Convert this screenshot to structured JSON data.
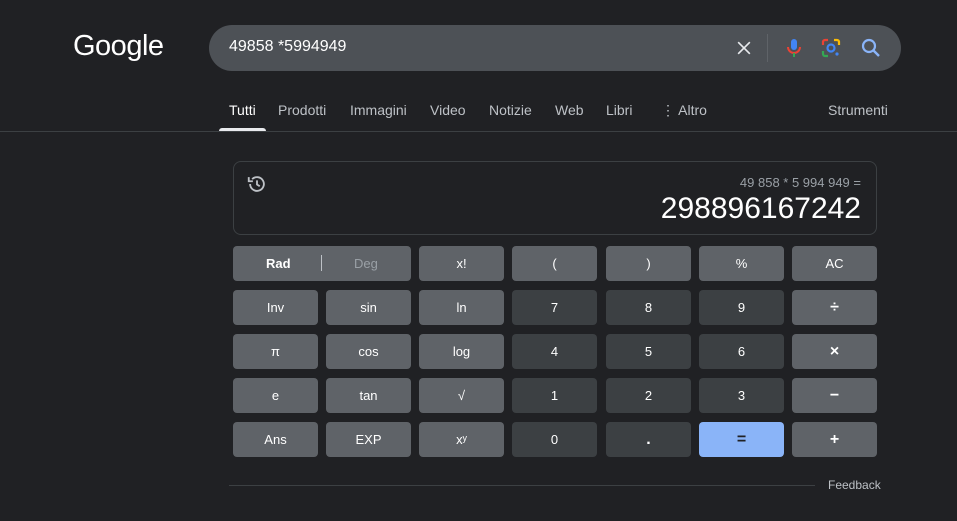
{
  "logo": {
    "text": "Google"
  },
  "search": {
    "query": "49858 *5994949"
  },
  "tabs": [
    {
      "label": "Tutti",
      "active": true
    },
    {
      "label": "Prodotti"
    },
    {
      "label": "Immagini"
    },
    {
      "label": "Video"
    },
    {
      "label": "Notizie"
    },
    {
      "label": "Web"
    },
    {
      "label": "Libri"
    },
    {
      "label": "⋮ Altro"
    }
  ],
  "tools_label": "Strumenti",
  "calculator": {
    "expression": "49 858 * 5 994 949 =",
    "result": "298896167242",
    "keys": {
      "rad": "Rad",
      "deg": "Deg",
      "fact": "x!",
      "lparen": "(",
      "rparen": ")",
      "percent": "%",
      "ac": "AC",
      "inv": "Inv",
      "sin": "sin",
      "ln": "ln",
      "n7": "7",
      "n8": "8",
      "n9": "9",
      "divide": "÷",
      "pi": "π",
      "cos": "cos",
      "log": "log",
      "n4": "4",
      "n5": "5",
      "n6": "6",
      "multiply": "×",
      "e": "e",
      "tan": "tan",
      "sqrt": "√",
      "n1": "1",
      "n2": "2",
      "n3": "3",
      "minus": "−",
      "ans": "Ans",
      "exp": "EXP",
      "pow": "xʸ",
      "n0": "0",
      "dot": ".",
      "equals": "=",
      "plus": "+"
    }
  },
  "feedback_label": "Feedback",
  "colors": {
    "background": "#202124",
    "searchbar": "#4d5156",
    "equals_key": "#8ab4f8"
  }
}
